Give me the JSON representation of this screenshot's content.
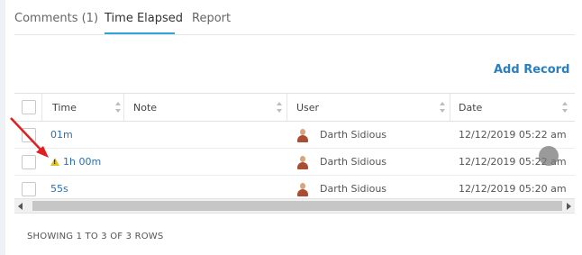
{
  "tabs": {
    "comments": "Comments (1)",
    "time_elapsed": "Time Elapsed",
    "report": "Report"
  },
  "toolbar": {
    "add_record": "Add Record"
  },
  "table": {
    "headers": {
      "time": "Time",
      "note": "Note",
      "user": "User",
      "date": "Date"
    },
    "rows": [
      {
        "time": "01m",
        "note": "",
        "user": "Darth Sidious",
        "date": "12/12/2019 05:22 am",
        "warning": false
      },
      {
        "time": "1h 00m",
        "note": "",
        "user": "Darth Sidious",
        "date": "12/12/2019 05:22 am",
        "warning": true
      },
      {
        "time": "55s",
        "note": "",
        "user": "Darth Sidious",
        "date": "12/12/2019 05:20 am",
        "warning": false
      }
    ]
  },
  "footer": {
    "showing": "SHOWING 1 TO 3 OF 3 ROWS"
  },
  "colors": {
    "accent": "#2fa4d6",
    "link": "#2a6fb5",
    "warning": "#e2c21b",
    "annotation": "#e02020"
  }
}
